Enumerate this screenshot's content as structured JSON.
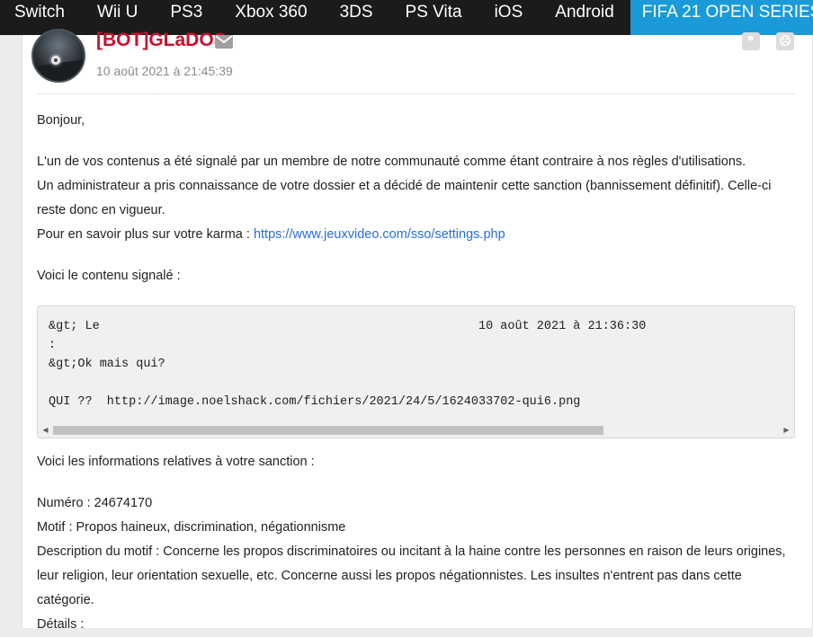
{
  "nav": {
    "items": [
      "Switch",
      "Wii U",
      "PS3",
      "Xbox 360",
      "3DS",
      "PS Vita",
      "iOS",
      "Android"
    ],
    "active_item": "FIFA 21 OPEN SERIES"
  },
  "post": {
    "author": "[BOT]GLaDOS",
    "date": "10 août 2021 à 21:45:39",
    "greeting": "Bonjour,",
    "line1": "L'un de vos contenus a été signalé par un membre de notre communauté comme étant contraire à nos règles d'utilisations.",
    "line2": "Un administrateur a pris connaissance de votre dossier et a décidé de maintenir cette sanction (bannissement définitif). Celle-ci reste donc en vigueur.",
    "karma_prefix": "Pour en savoir plus sur votre karma : ",
    "karma_link": "https://www.jeuxvideo.com/sso/settings.php",
    "reported_intro": "Voici le contenu signalé :",
    "code_lines": [
      "&gt; Le                                                    10 août 2021 à 21:36:30",
      ":",
      "&gt;Ok mais qui?",
      "",
      "QUI ??  http://image.noelshack.com/fichiers/2021/24/5/1624033702-qui6.png"
    ],
    "sanction_intro": "Voici les informations relatives à votre sanction :",
    "numero": "Numéro : 24674170",
    "motif": "Motif : Propos haineux, discrimination, négationnisme",
    "description": "Description du motif : Concerne les propos discriminatoires ou incitant à la haine contre les personnes en raison de leurs origines, leur religion, leur orientation sexuelle, etc. Concerne aussi les propos négationnistes. Les insultes n'entrent pas dans cette catégorie.",
    "details": "Détails :"
  },
  "icons": {
    "mail": "envelope-icon",
    "quote": "quote-icon",
    "report": "alert-face-icon"
  },
  "colors": {
    "nav_bg": "#1b1b1b",
    "nav_active": "#1a9ad8",
    "username": "#c8102e",
    "link": "#2a6ed2"
  }
}
